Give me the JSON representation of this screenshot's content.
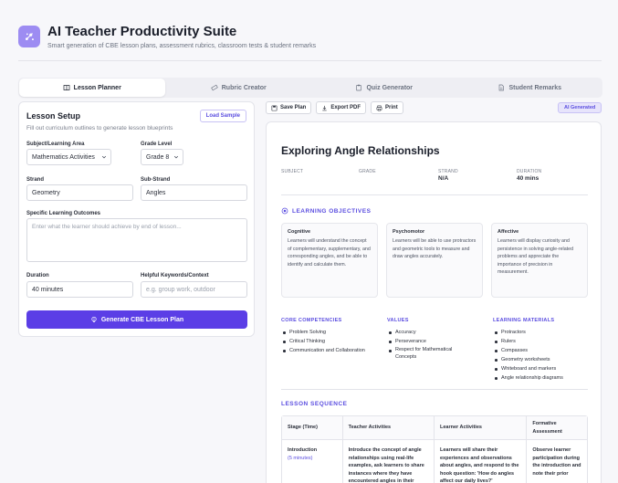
{
  "app": {
    "title": "AI Teacher Productivity Suite",
    "subtitle": "Smart generation of CBE lesson plans, assessment rubrics, classroom tests & student remarks"
  },
  "tabs": [
    {
      "label": "Lesson Planner",
      "icon": "book-icon",
      "active": true
    },
    {
      "label": "Rubric Creator",
      "icon": "ruler-icon",
      "active": false
    },
    {
      "label": "Quiz Generator",
      "icon": "clipboard-icon",
      "active": false
    },
    {
      "label": "Student Remarks",
      "icon": "file-icon",
      "active": false
    }
  ],
  "setup": {
    "title": "Lesson Setup",
    "load_sample": "Load Sample",
    "subtitle": "Fill out curriculum outlines to generate lesson blueprints",
    "subject_label": "Subject/Learning Area",
    "subject_value": "Mathematics Activities",
    "grade_label": "Grade Level",
    "grade_value": "Grade 8",
    "strand_label": "Strand",
    "strand_value": "Geometry",
    "substrand_label": "Sub-Strand",
    "substrand_value": "Angles",
    "outcomes_label": "Specific Learning Outcomes",
    "outcomes_placeholder": "Enter what the learner should achieve by end of lesson...",
    "duration_label": "Duration",
    "duration_value": "40 minutes",
    "keywords_label": "Helpful Keywords/Context",
    "keywords_placeholder": "e.g. group work, outdoor",
    "generate_label": "Generate CBE Lesson Plan"
  },
  "toolbar": {
    "save_label": "Save Plan",
    "export_label": "Export PDF",
    "print_label": "Print",
    "badge": "AI Generated"
  },
  "plan": {
    "title": "Exploring Angle Relationships",
    "meta": {
      "subject_label": "SUBJECT",
      "subject_value": "",
      "grade_label": "GRADE",
      "grade_value": "",
      "strand_label": "STRAND",
      "strand_value": "N/A",
      "duration_label": "DURATION",
      "duration_value": "40 mins"
    },
    "objectives_heading": "LEARNING OBJECTIVES",
    "objectives": [
      {
        "title": "Cognitive",
        "text": "Learners will understand the concept of complementary, supplementary, and corresponding angles, and be able to identify and calculate them."
      },
      {
        "title": "Psychomotor",
        "text": "Learners will be able to use protractors and geometric tools to measure and draw angles accurately."
      },
      {
        "title": "Affective",
        "text": "Learners will display curiosity and persistence in solving angle-related problems and appreciate the importance of precision in measurement."
      }
    ],
    "competencies_heading": "CORE COMPETENCIES",
    "competencies": [
      "Problem Solving",
      "Critical Thinking",
      "Communication and Collaboration"
    ],
    "values_heading": "VALUES",
    "values": [
      "Accuracy",
      "Perseverance",
      "Respect for Mathematical Concepts"
    ],
    "materials_heading": "LEARNING MATERIALS",
    "materials": [
      "Protractors",
      "Rulers",
      "Compasses",
      "Geometry worksheets",
      "Whiteboard and markers",
      "Angle relationship diagrams"
    ],
    "sequence_heading": "LESSON SEQUENCE",
    "sequence_columns": [
      "Stage (Time)",
      "Teacher Activities",
      "Learner Activities",
      "Formative Assessment"
    ],
    "sequence_rows": [
      {
        "stage": "Introduction",
        "time": "(5 minutes)",
        "teacher": "Introduce the concept of angle relationships using real-life examples, ask learners to share instances where they have encountered angles in their",
        "learner": "Learners will share their experiences and observations about angles, and respond to the hook question: 'How do angles affect our daily lives?'",
        "assessment": "Observe learner participation during the introduction and note their prior"
      }
    ]
  },
  "colors": {
    "accent": "#5b3ee6",
    "accent_text": "#5b4ee0",
    "logo": "#9d8cf2"
  }
}
